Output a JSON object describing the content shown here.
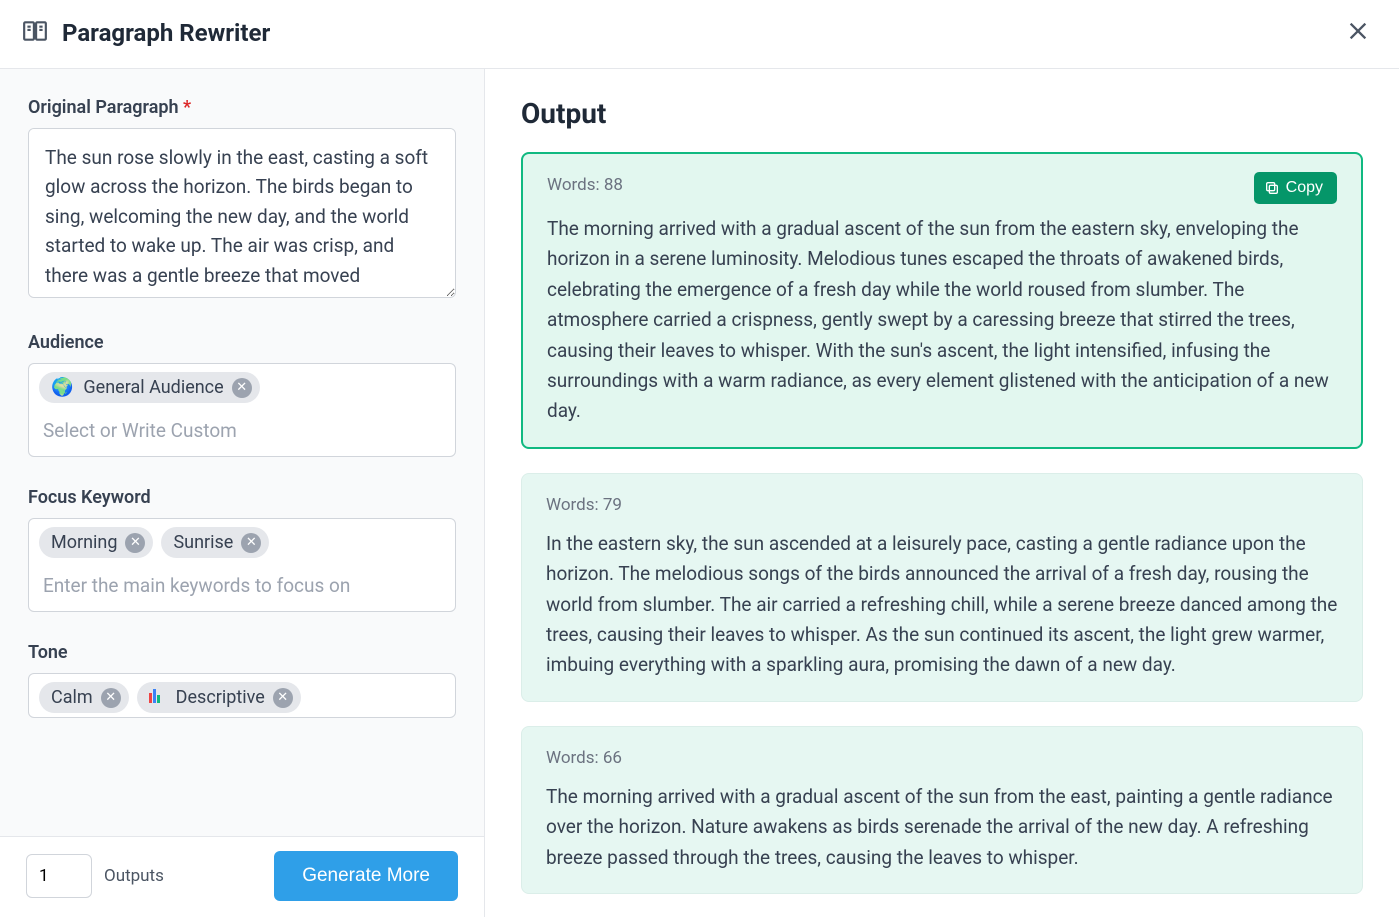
{
  "header": {
    "title": "Paragraph Rewriter"
  },
  "form": {
    "original_label": "Original Paragraph",
    "original_value": "The sun rose slowly in the east, casting a soft glow across the horizon. The birds began to sing, welcoming the new day, and the world started to wake up. The air was crisp, and there was a gentle breeze that moved",
    "audience_label": "Audience",
    "audience_placeholder": "Select or Write Custom",
    "audience_tags": [
      {
        "emoji": "🌍",
        "label": "General Audience"
      }
    ],
    "keyword_label": "Focus Keyword",
    "keyword_placeholder": "Enter the main keywords to focus on",
    "keyword_tags": [
      {
        "label": "Morning"
      },
      {
        "label": "Sunrise"
      }
    ],
    "tone_label": "Tone",
    "tone_tags": [
      {
        "label": "Calm"
      },
      {
        "icon": "bars",
        "label": "Descriptive"
      }
    ]
  },
  "footer": {
    "outputs_value": "1",
    "outputs_label": "Outputs",
    "generate_label": "Generate More"
  },
  "output": {
    "title": "Output",
    "copy_label": "Copy",
    "cards": [
      {
        "word_count_label": "Words: 88",
        "selected": true,
        "text": "The morning arrived with a gradual ascent of the sun from the eastern sky, enveloping the horizon in a serene luminosity. Melodious tunes escaped the throats of awakened birds, celebrating the emergence of a fresh day while the world roused from slumber. The atmosphere carried a crispness, gently swept by a caressing breeze that stirred the trees, causing their leaves to whisper. With the sun's ascent, the light intensified, infusing the surroundings with a warm radiance, as every element glistened with the anticipation of a new day."
      },
      {
        "word_count_label": "Words: 79",
        "selected": false,
        "text": "In the eastern sky, the sun ascended at a leisurely pace, casting a gentle radiance upon the horizon. The melodious songs of the birds announced the arrival of a fresh day, rousing the world from slumber. The air carried a refreshing chill, while a serene breeze danced among the trees, causing their leaves to whisper. As the sun continued its ascent, the light grew warmer, imbuing everything with a sparkling aura, promising the dawn of a new day."
      },
      {
        "word_count_label": "Words: 66",
        "selected": false,
        "text": "The morning arrived with a gradual ascent of the sun from the east, painting a gentle radiance over the horizon. Nature awakens as birds serenade the arrival of the new day. A refreshing breeze passed through the trees, causing the leaves to whisper."
      }
    ]
  }
}
